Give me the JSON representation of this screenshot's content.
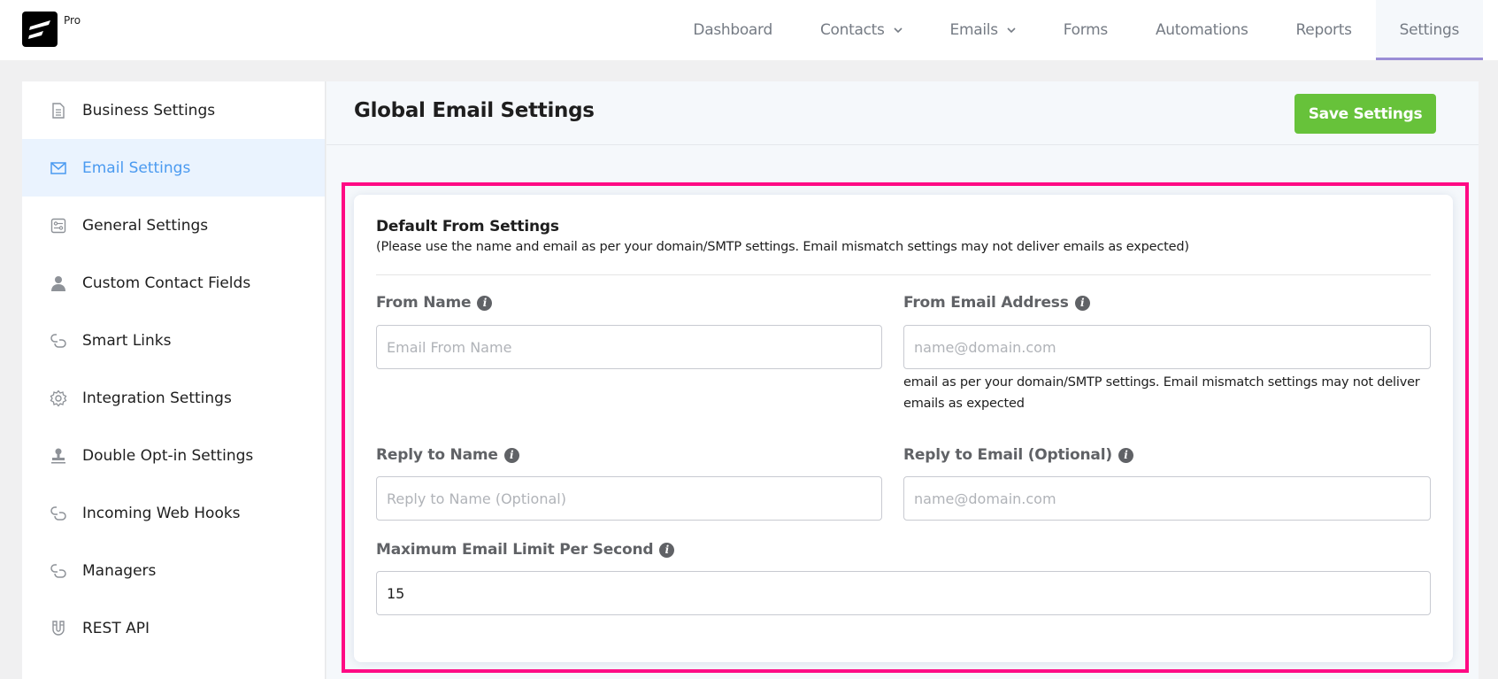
{
  "brand": {
    "badge": "Pro"
  },
  "nav": [
    {
      "label": "Dashboard",
      "dropdown": false,
      "active": false
    },
    {
      "label": "Contacts",
      "dropdown": true,
      "active": false
    },
    {
      "label": "Emails",
      "dropdown": true,
      "active": false
    },
    {
      "label": "Forms",
      "dropdown": false,
      "active": false
    },
    {
      "label": "Automations",
      "dropdown": false,
      "active": false
    },
    {
      "label": "Reports",
      "dropdown": false,
      "active": false
    },
    {
      "label": "Settings",
      "dropdown": false,
      "active": true
    }
  ],
  "sidebar": {
    "items": [
      {
        "label": "Business Settings",
        "icon": "document-icon",
        "active": false
      },
      {
        "label": "Email Settings",
        "icon": "envelope-icon",
        "active": true
      },
      {
        "label": "General Settings",
        "icon": "sliders-icon",
        "active": false
      },
      {
        "label": "Custom Contact Fields",
        "icon": "user-icon",
        "active": false
      },
      {
        "label": "Smart Links",
        "icon": "link-icon",
        "active": false
      },
      {
        "label": "Integration Settings",
        "icon": "gear-icon",
        "active": false
      },
      {
        "label": "Double Opt-in Settings",
        "icon": "stamp-icon",
        "active": false
      },
      {
        "label": "Incoming Web Hooks",
        "icon": "link-icon",
        "active": false
      },
      {
        "label": "Managers",
        "icon": "link-icon",
        "active": false
      },
      {
        "label": "REST API",
        "icon": "magnet-icon",
        "active": false
      }
    ]
  },
  "main": {
    "title": "Global Email Settings",
    "save_label": "Save Settings",
    "section": {
      "title": "Default From Settings",
      "subtitle": "(Please use the name and email as per your domain/SMTP settings. Email mismatch settings may not deliver emails as expected)"
    },
    "fields": {
      "from_name": {
        "label": "From Name",
        "placeholder": "Email From Name",
        "value": ""
      },
      "from_email": {
        "label": "From Email Address",
        "placeholder": "name@domain.com",
        "value": "",
        "help": "email as per your domain/SMTP settings. Email mismatch settings may not deliver emails as expected"
      },
      "reply_name": {
        "label": "Reply to Name",
        "placeholder": "Reply to Name (Optional)",
        "value": ""
      },
      "reply_email": {
        "label": "Reply to Email (Optional)",
        "placeholder": "name@domain.com",
        "value": ""
      },
      "max_limit": {
        "label": "Maximum Email Limit Per Second",
        "placeholder": "",
        "value": "15"
      }
    },
    "info_icon_glyph": "i"
  },
  "colors": {
    "accent": "#4a9af0",
    "save": "#67c23a",
    "highlight": "#ff0a84",
    "nav_active_underline": "#9a8ed6"
  }
}
